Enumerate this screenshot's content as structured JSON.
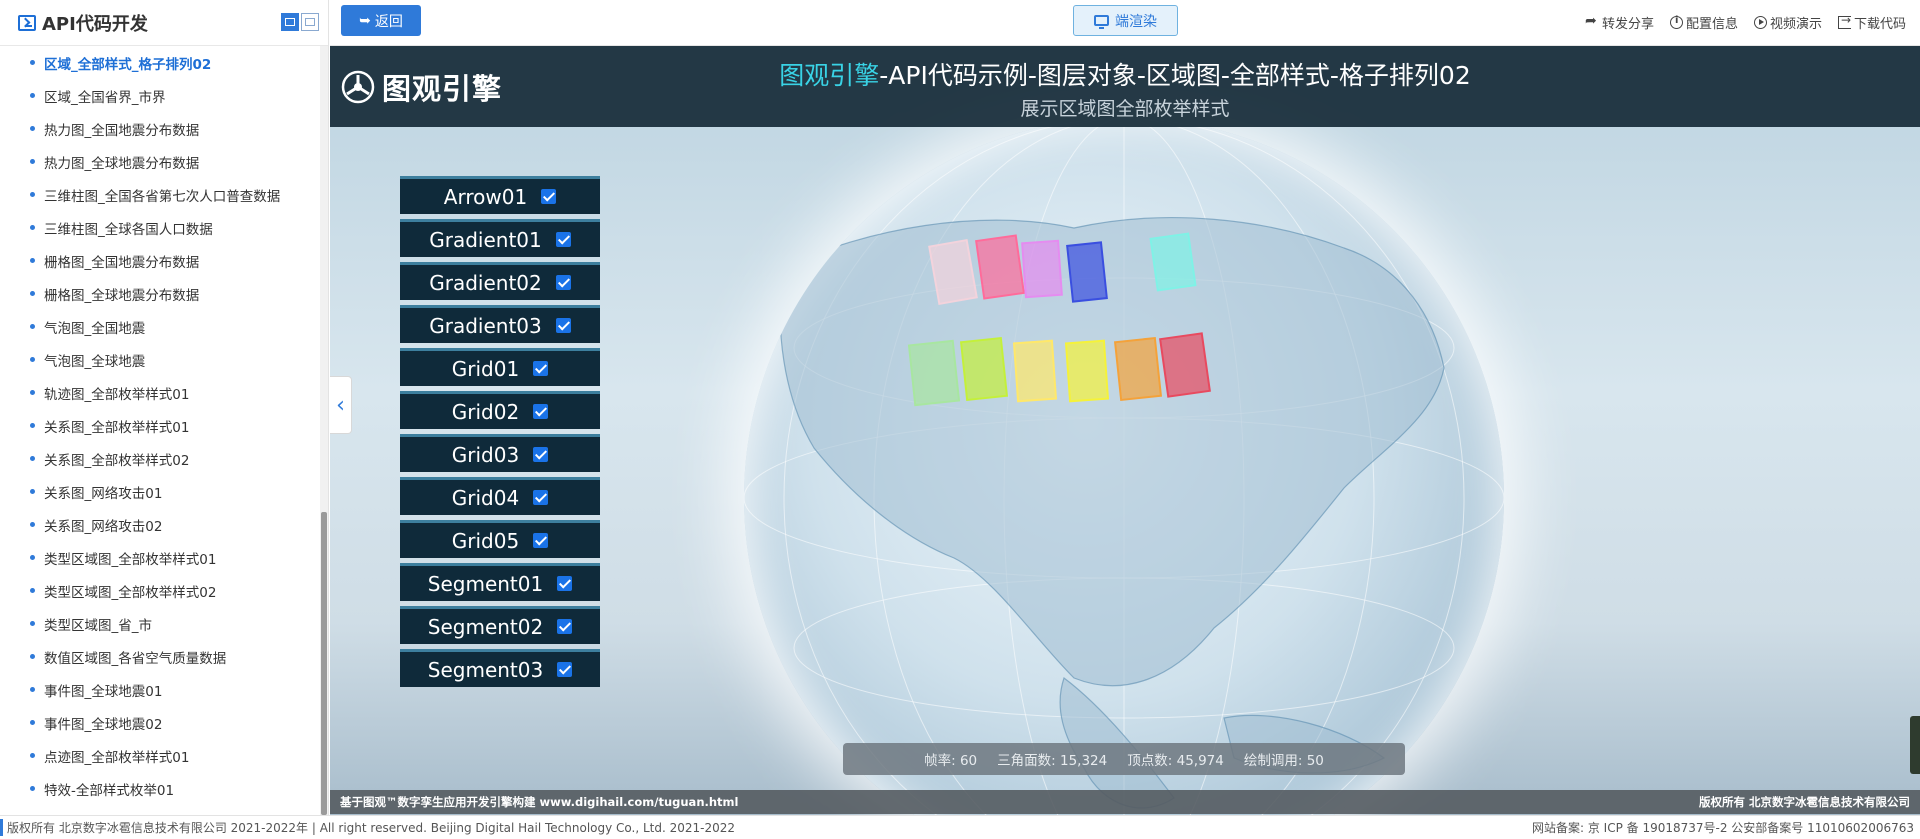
{
  "sidebar": {
    "title": "API代码开发",
    "active_index": 0,
    "items": [
      "区域_全部样式_格子排列02",
      "区域_全国省界_市界",
      "热力图_全国地震分布数据",
      "热力图_全球地震分布数据",
      "三维柱图_全国各省第七次人口普查数据",
      "三维柱图_全球各国人口数据",
      "栅格图_全国地震分布数据",
      "栅格图_全球地震分布数据",
      "气泡图_全国地震",
      "气泡图_全球地震",
      "轨迹图_全部枚举样式01",
      "关系图_全部枚举样式01",
      "关系图_全部枚举样式02",
      "关系图_网络攻击01",
      "关系图_网络攻击02",
      "类型区域图_全部枚举样式01",
      "类型区域图_全部枚举样式02",
      "类型区域图_省_市",
      "数值区域图_各省空气质量数据",
      "事件图_全球地震01",
      "事件图_全球地震02",
      "点迹图_全部枚举样式01",
      "特效-全部样式枚举01"
    ]
  },
  "topbar": {
    "back_label": "返回",
    "render_label": "端渲染",
    "links": {
      "share": "转发分享",
      "config": "配置信息",
      "video": "视频演示",
      "download": "下载代码"
    }
  },
  "scene": {
    "logo_text": "图观引擎",
    "title_accent": "图观引擎",
    "title_rest": "-API代码示例-图层对象-区域图-全部样式-格子排列02",
    "subtitle": "展示区域图全部枚举样式",
    "layers": [
      {
        "name": "Arrow01",
        "checked": true
      },
      {
        "name": "Gradient01",
        "checked": true
      },
      {
        "name": "Gradient02",
        "checked": true
      },
      {
        "name": "Gradient03",
        "checked": true
      },
      {
        "name": "Grid01",
        "checked": true
      },
      {
        "name": "Grid02",
        "checked": true
      },
      {
        "name": "Grid03",
        "checked": true
      },
      {
        "name": "Grid04",
        "checked": true
      },
      {
        "name": "Grid05",
        "checked": true
      },
      {
        "name": "Segment01",
        "checked": true
      },
      {
        "name": "Segment02",
        "checked": true
      },
      {
        "name": "Segment03",
        "checked": true
      }
    ],
    "stats": {
      "fps_label": "帧率:",
      "fps": "60",
      "tri_label": "三角面数:",
      "tri": "15,324",
      "vert_label": "顶点数:",
      "vert": "45,974",
      "draw_label": "绘制调用:",
      "draw": "50"
    },
    "footer_left": "基于图观™数字孪生应用开发引擎构建 www.digihail.com/tuguan.html",
    "footer_right": "版权所有 北京数字冰雹信息技术有限公司",
    "region_colors": [
      "#f3d3dc",
      "#ff6b9a",
      "#e58cf0",
      "#3a4fe0",
      "#7ff2e6",
      "#a8e6a0",
      "#c4f03a",
      "#ffe86a",
      "#f5f23a",
      "#f4a23a",
      "#e84a5f"
    ]
  },
  "copyright": {
    "left": "版权所有 北京数字冰雹信息技术有限公司 2021-2022年 | All right reserved. Beijing Digital Hail Technology Co., Ltd. 2021-2022",
    "right": "网站备案: 京 ICP 备 19018737号-2 公安部备案号 11010602006763"
  }
}
